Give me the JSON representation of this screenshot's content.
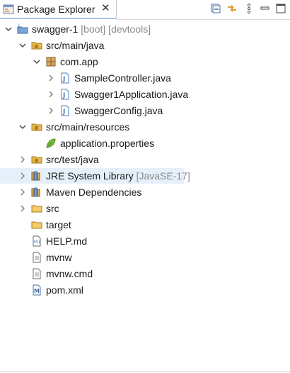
{
  "view": {
    "title": "Package Explorer",
    "close_glyph": "✕"
  },
  "toolbar": {
    "buttons": [
      "collapse-all-icon",
      "link-with-editor-icon",
      "view-menu-icon",
      "minimize-icon"
    ]
  },
  "tree": {
    "project": {
      "label": "swagger-1",
      "decoration": "[boot] [devtools]"
    },
    "src_main_java": {
      "label": "src/main/java"
    },
    "package_com_app": {
      "label": "com.app"
    },
    "file_sample_controller": {
      "label": "SampleController.java"
    },
    "file_swagger1_application": {
      "label": "Swagger1Application.java"
    },
    "file_swagger_config": {
      "label": "SwaggerConfig.java"
    },
    "src_main_resources": {
      "label": "src/main/resources"
    },
    "file_application_properties": {
      "label": "application.properties"
    },
    "src_test_java": {
      "label": "src/test/java"
    },
    "jre_library": {
      "label": "JRE System Library",
      "decoration": "[JavaSE-17]"
    },
    "maven_dependencies": {
      "label": "Maven Dependencies"
    },
    "folder_src": {
      "label": "src"
    },
    "folder_target": {
      "label": "target"
    },
    "file_help_md": {
      "label": "HELP.md"
    },
    "file_mvnw": {
      "label": "mvnw"
    },
    "file_mvnw_cmd": {
      "label": "mvnw.cmd"
    },
    "file_pom_xml": {
      "label": "pom.xml"
    }
  },
  "colors": {
    "selection": "#e5f0fb",
    "decoration_text": "#8a8a8a",
    "folder": "#e8b84a",
    "java_file": "#4a7fc1",
    "package": "#b07a3a"
  }
}
